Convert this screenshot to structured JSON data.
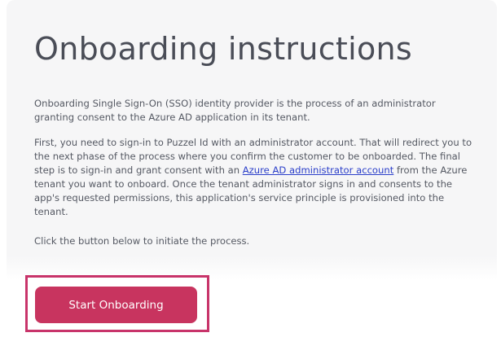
{
  "page": {
    "title": "Onboarding instructions"
  },
  "instructions": {
    "paragraph1": "Onboarding Single Sign-On (SSO) identity provider is the process of an administrator granting consent to the Azure AD application in its tenant.",
    "paragraph2_before_link": "First, you need to sign-in to Puzzel Id with an administrator account. That will redirect you to the next phase of the process where you confirm the customer to be onboarded. The final step is to sign-in and grant consent with an ",
    "paragraph2_link": "Azure AD administrator account",
    "paragraph2_after_link": " from the Azure tenant you want to onboard. Once the tenant administrator signs in and consents to the app's requested permissions, this application's service principle is provisioned into the tenant.",
    "paragraph3": "Click the button below to initiate the process."
  },
  "actions": {
    "start_label": "Start Onboarding"
  },
  "colors": {
    "button": "#c8345f",
    "highlight_border": "#c8346a",
    "link": "#2b3fc9",
    "title": "#4a4d57",
    "card_bg": "#f6f6f7"
  }
}
